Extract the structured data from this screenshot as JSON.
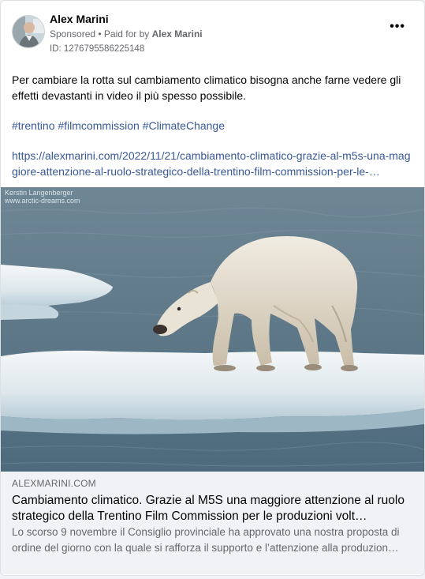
{
  "post": {
    "author": "Alex Marini",
    "sponsored": "Sponsored",
    "separator": " • ",
    "paid_prefix": "Paid for by ",
    "paid_by": "Alex Marini",
    "ad_id": "ID: 1276795586225148",
    "more_label": "•••",
    "text": "Per cambiare la rotta sul cambiamento climatico bisogna anche farne vedere gli effetti devastanti in video il più spesso possibile.",
    "hashtags": "#trentino #filmcommission #ClimateChange",
    "url": "https://alexmarini.com/2022/11/21/cambiamento-climatico-grazie-al-m5s-una-maggiore-attenzione-al-ruolo-strategico-della-trentino-film-commission-per-le-…"
  },
  "media": {
    "watermark_line1": "Kerstin Langenberger",
    "watermark_line2": "www.arctic-dreams.com"
  },
  "link_preview": {
    "domain": "ALEXMARINI.COM",
    "title": "Cambiamento climatico. Grazie al M5S una maggiore attenzione al ruolo strategico della Trentino Film Commission per le produzioni volt…",
    "description": "Lo scorso 9 novembre il Consiglio provinciale ha approvato una nostra proposta di ordine del giorno con la quale si rafforza il supporto e l’attenzione alla produzion…"
  },
  "icons": {
    "more": "more-horizontal-icon"
  }
}
